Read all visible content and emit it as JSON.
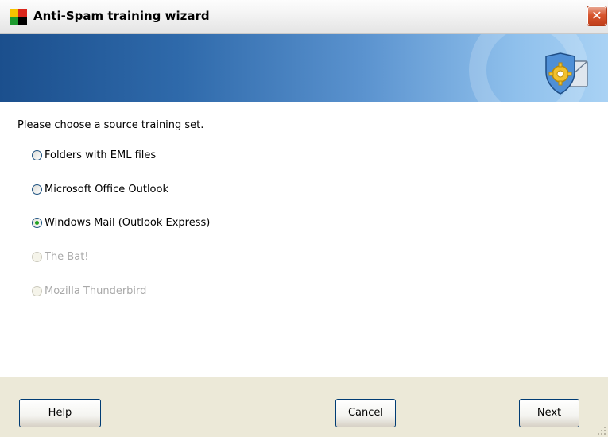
{
  "window": {
    "title": "Anti-Spam training wizard",
    "close_label": "✕"
  },
  "content": {
    "prompt": "Please choose a source training set.",
    "options": [
      {
        "label": "Folders with EML files",
        "selected": false,
        "enabled": true
      },
      {
        "label": "Microsoft Office Outlook",
        "selected": false,
        "enabled": true
      },
      {
        "label": "Windows Mail (Outlook Express)",
        "selected": true,
        "enabled": true
      },
      {
        "label": "The Bat!",
        "selected": false,
        "enabled": false
      },
      {
        "label": "Mozilla Thunderbird",
        "selected": false,
        "enabled": false
      }
    ]
  },
  "footer": {
    "help_label": "Help",
    "cancel_label": "Cancel",
    "next_label": "Next"
  },
  "colors": {
    "banner_start": "#1b4f8d",
    "banner_end": "#a9d2f4",
    "selected_dot": "#21a121",
    "disabled_text": "#a9a9a9"
  }
}
